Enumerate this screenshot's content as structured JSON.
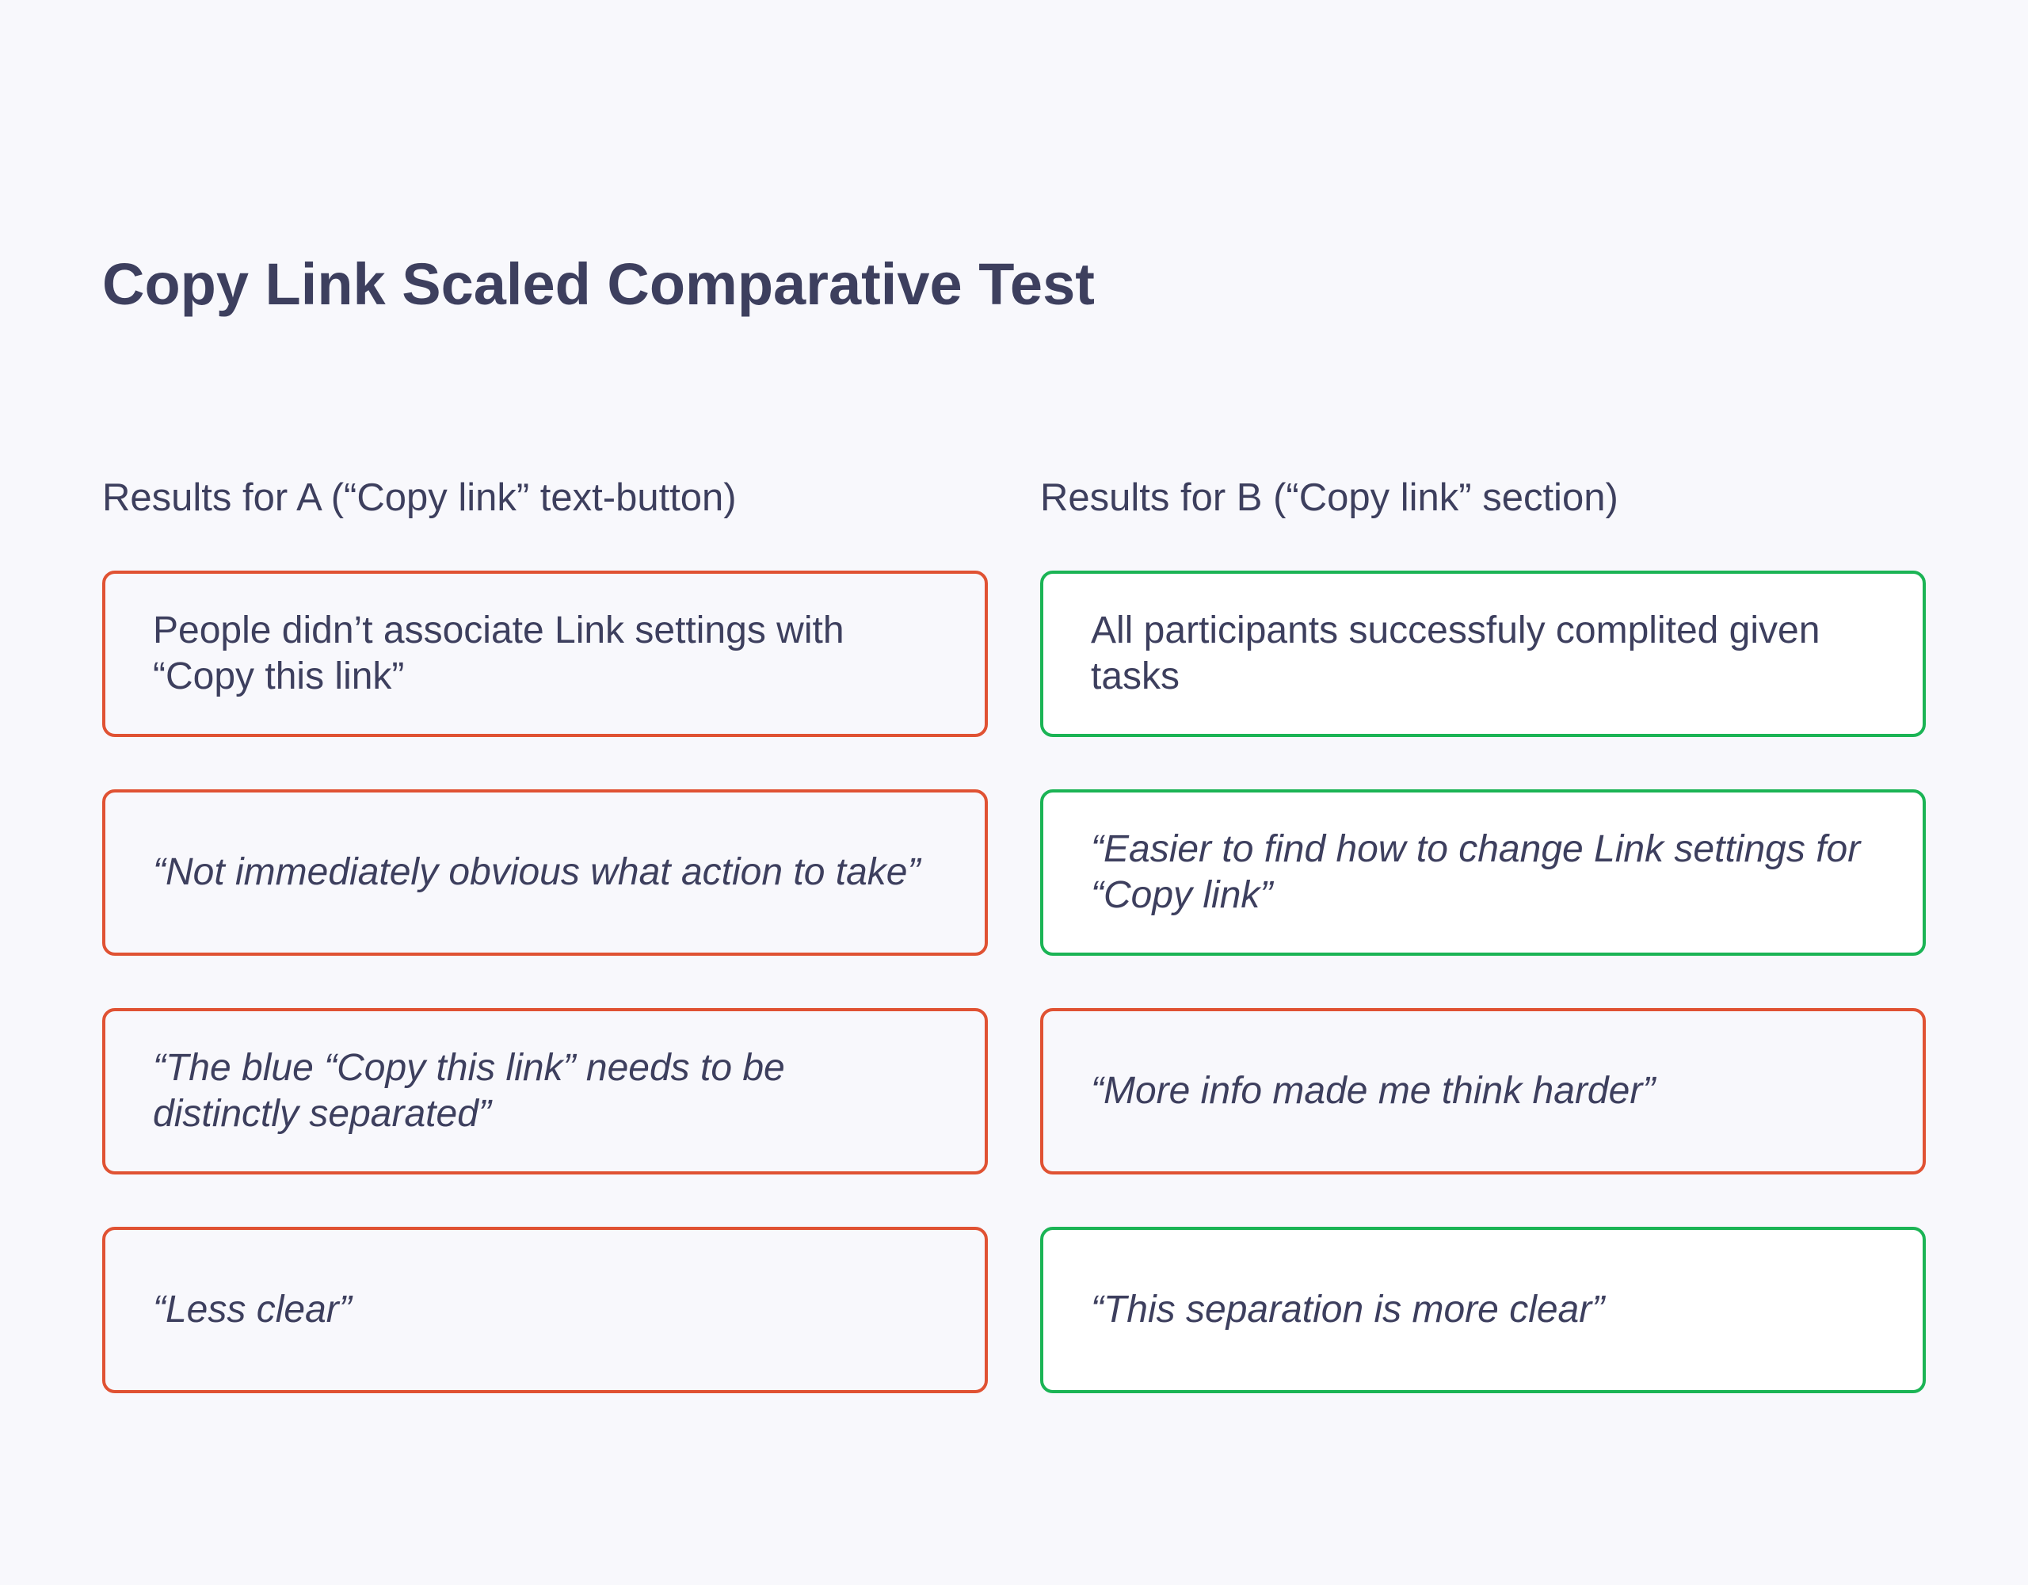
{
  "page": {
    "title": "Copy Link Scaled Comparative Test"
  },
  "colors": {
    "text": "#3d3f5e",
    "background": "#f8f8fc",
    "negative_border": "#e05233",
    "positive_border": "#1bb455"
  },
  "columns": {
    "a": {
      "heading": "Results for A (“Copy link” text-button)",
      "cards": [
        {
          "text": "People didn’t associate Link settings with “Copy this link”",
          "sentiment": "negative",
          "style": "plain"
        },
        {
          "text": "“Not immediately obvious what action to take”",
          "sentiment": "negative",
          "style": "quote"
        },
        {
          "text": "“The blue “Copy this link” needs to be distinctly separated”",
          "sentiment": "negative",
          "style": "quote"
        },
        {
          "text": "“Less clear”",
          "sentiment": "negative",
          "style": "quote"
        }
      ]
    },
    "b": {
      "heading": "Results for B (“Copy link” section)",
      "cards": [
        {
          "text": "All participants successfuly complited given tasks",
          "sentiment": "positive",
          "style": "plain"
        },
        {
          "text": "“Easier to find how to change Link settings for “Copy link”",
          "sentiment": "positive",
          "style": "quote"
        },
        {
          "text": "“More info made me think harder”",
          "sentiment": "negative",
          "style": "quote"
        },
        {
          "text": "“This separation is more clear”",
          "sentiment": "positive",
          "style": "quote"
        }
      ]
    }
  }
}
